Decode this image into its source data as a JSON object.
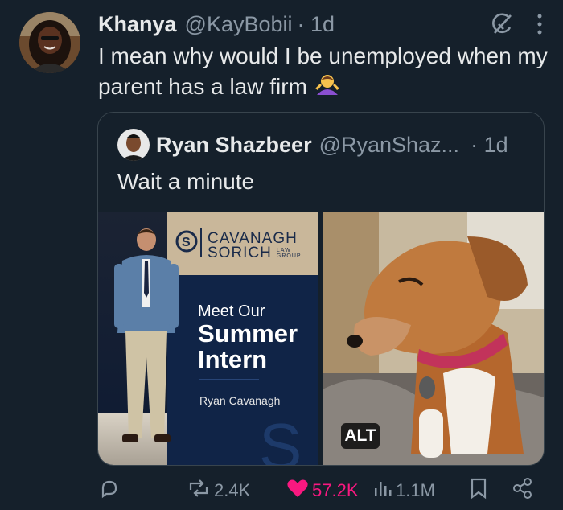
{
  "tweet": {
    "author_name": "Khanya",
    "author_handle": "@KayBobii",
    "time": "· 1d",
    "text": "I mean why would I be unemployed when my parent has a law firm",
    "emoji": "person-shrugging-emoji"
  },
  "quoted": {
    "author_name": "Ryan Shazbeer",
    "author_handle": "@RyanShaz...",
    "time": "· 1d",
    "text": "Wait a minute",
    "image_left": {
      "firm_line1": "CAVANAGH",
      "firm_line2": "SORICH",
      "firm_small": [
        "LAW",
        "GROUP"
      ],
      "headline_small": "Meet Our",
      "headline_big1": "Summer",
      "headline_big2": "Intern",
      "name": "Ryan Cavanagh",
      "logo_letter": "S"
    },
    "alt_badge": "ALT"
  },
  "actions": {
    "reply": "",
    "retweets": "2.4K",
    "likes": "57.2K",
    "views": "1.1M"
  },
  "colors": {
    "background": "#15202b",
    "like": "#f91880",
    "muted": "#8b98a5",
    "text": "#e7e9ea",
    "border": "#38444d"
  },
  "icons": [
    "grok-icon",
    "more-icon",
    "reply-icon",
    "retweet-icon",
    "heart-icon",
    "views-icon",
    "bookmark-icon",
    "share-icon"
  ]
}
